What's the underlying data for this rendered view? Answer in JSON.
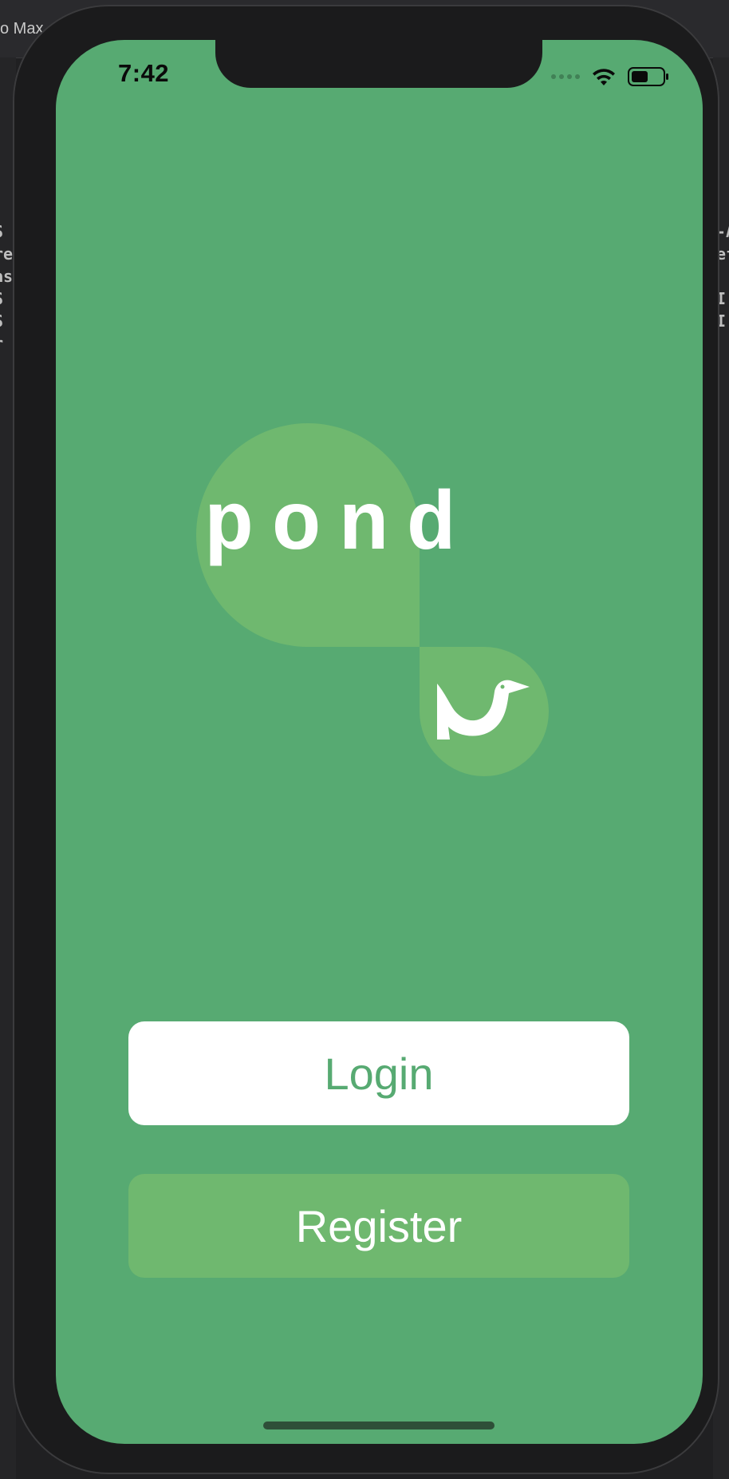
{
  "background": {
    "tab_text": "o Max",
    "left_code_lines": [
      "S",
      "re",
      "as",
      "S",
      "S",
      "r"
    ],
    "right_code_lines": [
      "-A",
      "ef",
      "",
      "I",
      "I"
    ]
  },
  "status_bar": {
    "time": "7:42",
    "icons": [
      "signal-icon",
      "wifi-icon",
      "battery-icon"
    ]
  },
  "logo": {
    "word": "pond",
    "icon": "bird-icon"
  },
  "buttons": {
    "login_label": "Login",
    "register_label": "Register"
  },
  "colors": {
    "screen_bg": "#57aa72",
    "accent": "#6fb86f",
    "white": "#ffffff"
  }
}
